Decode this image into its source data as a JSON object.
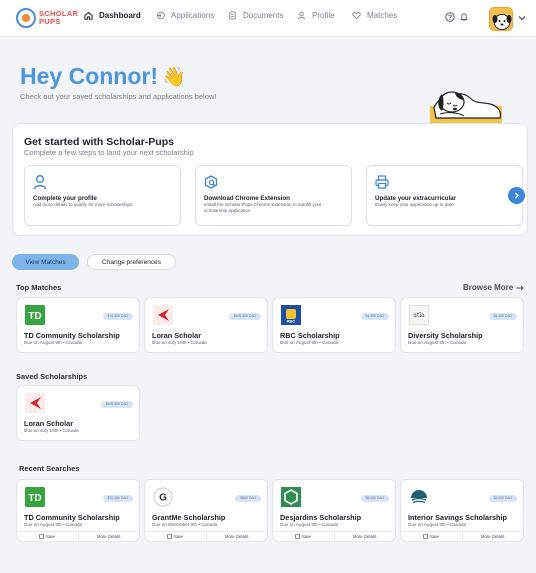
{
  "nav": {
    "logo_line1": "SCHOLAR",
    "logo_line2": "PUPS",
    "items": [
      {
        "label": "Dashboard",
        "icon": "home-icon",
        "active": true
      },
      {
        "label": "Applications",
        "icon": "applications-icon",
        "active": false
      },
      {
        "label": "Documents",
        "icon": "document-icon",
        "active": false
      },
      {
        "label": "Profile",
        "icon": "user-icon",
        "active": false
      },
      {
        "label": "Matches",
        "icon": "heart-icon",
        "active": false
      }
    ]
  },
  "hero": {
    "greeting": "Hey Connor!",
    "emoji": "👋",
    "subtitle": "Check out your saved scholarships and applications below!"
  },
  "get_started": {
    "title": "Get started with Scholar-Pups",
    "subtitle": "Complete a few steps to land your next scholarship",
    "steps": [
      {
        "title": "Complete your profile",
        "desc": "Add more details to qualify for more scholarships",
        "icon": "user-icon"
      },
      {
        "title": "Download Chrome Extension",
        "desc": "Install the Scholar-Pups Chrome Extension to autofill your scholarship application",
        "icon": "extension-search-icon"
      },
      {
        "title": "Update your extracurricular",
        "desc": "Easily keep your application up to date.",
        "icon": "printer-icon"
      }
    ]
  },
  "actions": {
    "view_matches": "View Matches",
    "change_preferences": "Change preferences"
  },
  "top_matches": {
    "title": "Top Matches",
    "browse_more": "Browse More",
    "cards": [
      {
        "name": "TD Community Scholarship",
        "meta": "Due on August 9th • Canada",
        "amount": "$70,000 CAD",
        "logo": "td"
      },
      {
        "name": "Loran Scholar",
        "meta": "Due on July 10th • Canada",
        "amount": "$100,000 CAD",
        "logo": "loran"
      },
      {
        "name": "RBC Scholarship",
        "meta": "Due on August 9th • Canada",
        "amount": "$1,000 CAD",
        "logo": "rbc"
      },
      {
        "name": "Diversity Scholarship",
        "meta": "Due on August 9th • Canada",
        "amount": "$5,000 CAD",
        "logo": "atla",
        "logo_text": "atla"
      }
    ]
  },
  "saved": {
    "title": "Saved Scholarships",
    "cards": [
      {
        "name": "Loran Scholar",
        "meta": "Due on July 10th • Canada",
        "amount": "$100,000 CAD",
        "logo": "loran"
      }
    ]
  },
  "recent": {
    "title": "Recent Searches",
    "save_label": "Save",
    "details_label": "More Details",
    "cards": [
      {
        "name": "TD Community Scholarship",
        "meta": "Due on August 9th • Canada",
        "amount": "$70,000 CAD",
        "logo": "td"
      },
      {
        "name": "GrantMe Scholarship",
        "meta": "Due on December 9th • Canada",
        "amount": "$800 CAD",
        "logo": "grantme"
      },
      {
        "name": "Desjardins Scholarship",
        "meta": "Due on August 9th • Canada",
        "amount": "$5,000 CAD",
        "logo": "desjardins"
      },
      {
        "name": "Interior Savings Scholarship",
        "meta": "Due on August 9th • Canada",
        "amount": "$2,000 CAD",
        "logo": "interior-savings"
      }
    ]
  },
  "colors": {
    "accent": "#4d95e0",
    "primary_button": "#7fb3ea",
    "td_green": "#37a53f",
    "desjardins_green": "#2f8d4e",
    "rbc_blue": "#1f4fa3"
  }
}
